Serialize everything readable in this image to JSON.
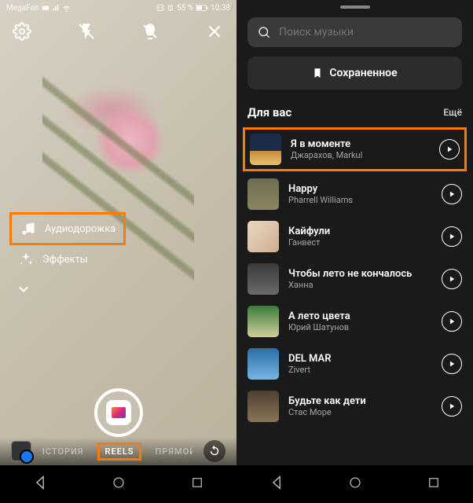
{
  "status": {
    "carrier": "MegaFon",
    "battery_text": "55 %",
    "time": "10:38"
  },
  "left": {
    "options": {
      "audio": "Аудиодорожка",
      "effects": "Эффекты"
    },
    "modes": {
      "story": "ИСТОРИЯ",
      "reels": "REELS",
      "live": "ПРЯМОЙ"
    }
  },
  "right": {
    "search_placeholder": "Поиск музыки",
    "saved_label": "Сохраненное",
    "section_title": "Для вас",
    "more_label": "Ещё",
    "tracks": [
      {
        "title": "Я в моменте",
        "artist": "Джарахов, Markul"
      },
      {
        "title": "Happy",
        "artist": "Pharrell Williams"
      },
      {
        "title": "Кайфули",
        "artist": "Ганвест"
      },
      {
        "title": "Чтобы лето не кончалось",
        "artist": "Ханна"
      },
      {
        "title": "А лето цвета",
        "artist": "Юрий Шатунов"
      },
      {
        "title": "DEL MAR",
        "artist": "Zivert"
      },
      {
        "title": "Будьте как дети",
        "artist": "Стас Море"
      }
    ]
  }
}
